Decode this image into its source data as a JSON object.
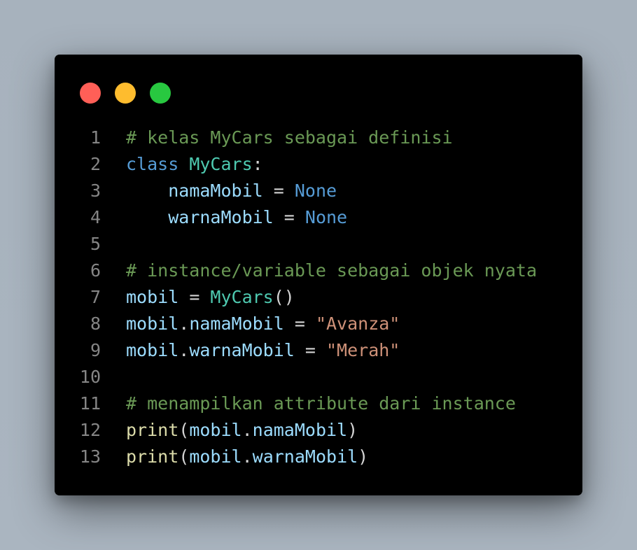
{
  "window": {
    "dots": [
      {
        "name": "close",
        "color": "#ff5f57"
      },
      {
        "name": "minimize",
        "color": "#febc2e"
      },
      {
        "name": "maximize",
        "color": "#28c840"
      }
    ]
  },
  "code": {
    "lines": [
      {
        "number": "1",
        "tokens": [
          {
            "t": "# kelas MyCars sebagai definisi",
            "c": "comment"
          }
        ]
      },
      {
        "number": "2",
        "tokens": [
          {
            "t": "class",
            "c": "kw"
          },
          {
            "t": " ",
            "c": "op"
          },
          {
            "t": "MyCars",
            "c": "cls"
          },
          {
            "t": ":",
            "c": "op"
          }
        ]
      },
      {
        "number": "3",
        "tokens": [
          {
            "t": "    ",
            "c": "op"
          },
          {
            "t": "namaMobil",
            "c": "var"
          },
          {
            "t": " = ",
            "c": "op"
          },
          {
            "t": "None",
            "c": "none"
          }
        ]
      },
      {
        "number": "4",
        "tokens": [
          {
            "t": "    ",
            "c": "op"
          },
          {
            "t": "warnaMobil",
            "c": "var"
          },
          {
            "t": " = ",
            "c": "op"
          },
          {
            "t": "None",
            "c": "none"
          }
        ]
      },
      {
        "number": "5",
        "tokens": []
      },
      {
        "number": "6",
        "tokens": [
          {
            "t": "# instance/variable sebagai objek nyata",
            "c": "comment"
          }
        ]
      },
      {
        "number": "7",
        "tokens": [
          {
            "t": "mobil",
            "c": "var"
          },
          {
            "t": " = ",
            "c": "op"
          },
          {
            "t": "MyCars",
            "c": "cls"
          },
          {
            "t": "()",
            "c": "op"
          }
        ]
      },
      {
        "number": "8",
        "tokens": [
          {
            "t": "mobil",
            "c": "var"
          },
          {
            "t": ".",
            "c": "op"
          },
          {
            "t": "namaMobil",
            "c": "var"
          },
          {
            "t": " = ",
            "c": "op"
          },
          {
            "t": "\"Avanza\"",
            "c": "str"
          }
        ]
      },
      {
        "number": "9",
        "tokens": [
          {
            "t": "mobil",
            "c": "var"
          },
          {
            "t": ".",
            "c": "op"
          },
          {
            "t": "warnaMobil",
            "c": "var"
          },
          {
            "t": " = ",
            "c": "op"
          },
          {
            "t": "\"Merah\"",
            "c": "str"
          }
        ]
      },
      {
        "number": "10",
        "tokens": []
      },
      {
        "number": "11",
        "tokens": [
          {
            "t": "# menampilkan attribute dari instance",
            "c": "comment"
          }
        ]
      },
      {
        "number": "12",
        "tokens": [
          {
            "t": "print",
            "c": "fn"
          },
          {
            "t": "(",
            "c": "op"
          },
          {
            "t": "mobil",
            "c": "var"
          },
          {
            "t": ".",
            "c": "op"
          },
          {
            "t": "namaMobil",
            "c": "var"
          },
          {
            "t": ")",
            "c": "op"
          }
        ]
      },
      {
        "number": "13",
        "tokens": [
          {
            "t": "print",
            "c": "fn"
          },
          {
            "t": "(",
            "c": "op"
          },
          {
            "t": "mobil",
            "c": "var"
          },
          {
            "t": ".",
            "c": "op"
          },
          {
            "t": "warnaMobil",
            "c": "var"
          },
          {
            "t": ")",
            "c": "op"
          }
        ]
      }
    ]
  }
}
